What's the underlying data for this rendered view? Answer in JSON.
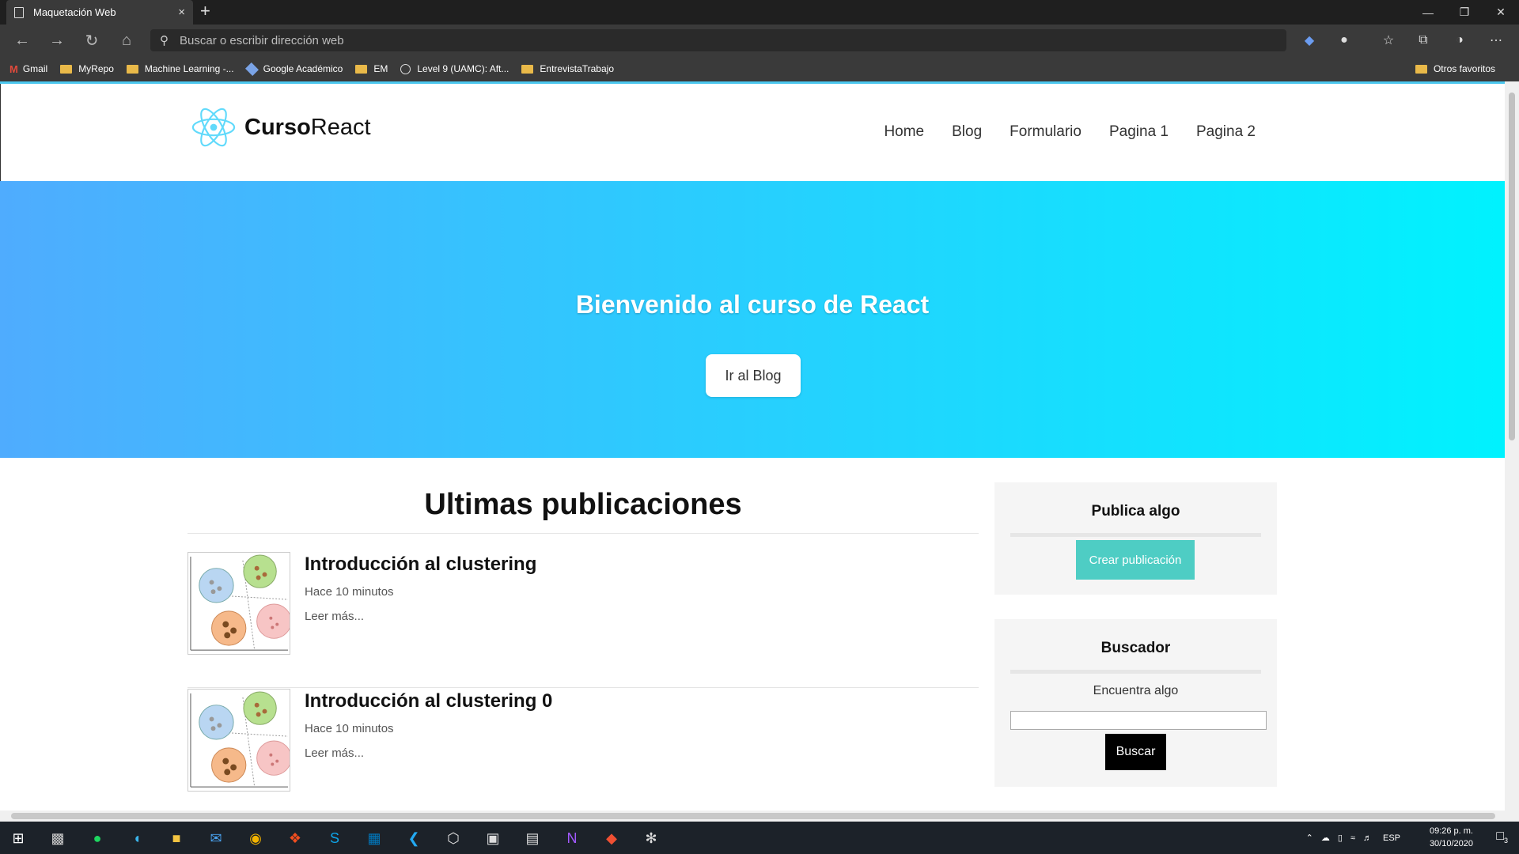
{
  "browser": {
    "tab_title": "Maquetación Web",
    "tab_close": "×",
    "new_tab": "+",
    "address_placeholder": "Buscar o escribir dirección web",
    "bookmarks": [
      {
        "label": "Gmail",
        "icon": "gmail-icon"
      },
      {
        "label": "MyRepo",
        "icon": "folder-icon"
      },
      {
        "label": "Machine Learning -...",
        "icon": "folder-icon"
      },
      {
        "label": "Google Académico",
        "icon": "scholar-icon"
      },
      {
        "label": "EM",
        "icon": "folder-icon"
      },
      {
        "label": "Level 9 (UAMC): Aft...",
        "icon": "site-icon"
      },
      {
        "label": "EntrevistaTrabajo",
        "icon": "folder-icon"
      }
    ],
    "other_favorites": "Otros favoritos"
  },
  "site": {
    "logo_bold": "Curso",
    "logo_light": "React",
    "nav": [
      "Home",
      "Blog",
      "Formulario",
      "Pagina 1",
      "Pagina 2"
    ],
    "hero_title": "Bienvenido al curso de React",
    "hero_button": "Ir al Blog",
    "hero_gradient": [
      "#4facfe",
      "#00f2fe"
    ]
  },
  "main": {
    "heading": "Ultimas publicaciones",
    "posts": [
      {
        "title": "Introducción al clustering",
        "time": "Hace 10 minutos",
        "more": "Leer más..."
      },
      {
        "title": "Introducción al clustering 0",
        "time": "Hace 10 minutos",
        "more": "Leer más..."
      }
    ]
  },
  "sidebar": {
    "publish_title": "Publica algo",
    "publish_button": "Crear publicación",
    "search_title": "Buscador",
    "search_label": "Encuentra algo",
    "search_button": "Buscar",
    "accent": "#4ecdc4"
  },
  "taskbar": {
    "lang": "ESP",
    "time": "09:26 p. m.",
    "date": "30/10/2020",
    "notifications": "3"
  }
}
